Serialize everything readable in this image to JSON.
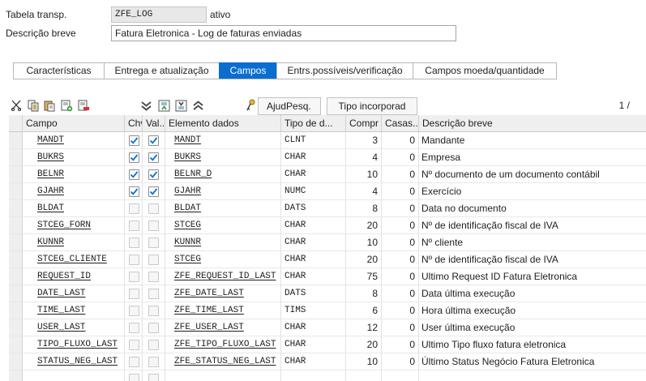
{
  "header": {
    "table_label": "Tabela transp.",
    "table_value": "ZFE_LOG",
    "status": "ativo",
    "desc_label": "Descrição breve",
    "desc_value": "Fatura Eletronica - Log de faturas enviadas"
  },
  "tabs": [
    {
      "label": "Características",
      "active": false
    },
    {
      "label": "Entrega e atualização",
      "active": false
    },
    {
      "label": "Campos",
      "active": true
    },
    {
      "label": "Entrs.possíveis/verificação",
      "active": false
    },
    {
      "label": "Campos moeda/quantidade",
      "active": false
    }
  ],
  "toolbar": {
    "icons": [
      "cut-icon",
      "copy-icon",
      "paste-icon",
      "insert-row-icon",
      "delete-row-icon"
    ],
    "nav_icons": [
      "scroll-down-icon",
      "first-page-icon",
      "last-page-icon",
      "scroll-up-icon"
    ],
    "search_help_label": "AjudPesq.",
    "builtin_type_label": "Tipo incorporad",
    "pager": "1 /"
  },
  "colors": {
    "accent": "#0a6ed1",
    "check": "#0a6ed1",
    "header_bg": "#efefef"
  },
  "table": {
    "columns": [
      "Campo",
      "Chv",
      "Val...",
      "Elemento dados",
      "Tipo de d...",
      "Compr",
      "Casas...",
      "Descrição breve"
    ],
    "rows": [
      {
        "field": "MANDT",
        "key": true,
        "init": true,
        "element": "MANDT",
        "type": "CLNT",
        "length": "3",
        "decimals": "0",
        "desc": "Mandante"
      },
      {
        "field": "BUKRS",
        "key": true,
        "init": true,
        "element": "BUKRS",
        "type": "CHAR",
        "length": "4",
        "decimals": "0",
        "desc": "Empresa"
      },
      {
        "field": "BELNR",
        "key": true,
        "init": true,
        "element": "BELNR_D",
        "type": "CHAR",
        "length": "10",
        "decimals": "0",
        "desc": "Nº documento de um documento contábil"
      },
      {
        "field": "GJAHR",
        "key": true,
        "init": true,
        "element": "GJAHR",
        "type": "NUMC",
        "length": "4",
        "decimals": "0",
        "desc": "Exercício"
      },
      {
        "field": "BLDAT",
        "key": false,
        "init": false,
        "element": "BLDAT",
        "type": "DATS",
        "length": "8",
        "decimals": "0",
        "desc": "Data no documento"
      },
      {
        "field": "STCEG_FORN",
        "key": false,
        "init": false,
        "element": "STCEG",
        "type": "CHAR",
        "length": "20",
        "decimals": "0",
        "desc": "Nº de identificação fiscal de IVA"
      },
      {
        "field": "KUNNR",
        "key": false,
        "init": false,
        "element": "KUNNR",
        "type": "CHAR",
        "length": "10",
        "decimals": "0",
        "desc": "Nº cliente"
      },
      {
        "field": "STCEG_CLIENTE",
        "key": false,
        "init": false,
        "element": "STCEG",
        "type": "CHAR",
        "length": "20",
        "decimals": "0",
        "desc": "Nº de identificação fiscal de IVA"
      },
      {
        "field": "REQUEST_ID",
        "key": false,
        "init": false,
        "element": "ZFE_REQUEST_ID_LAST",
        "type": "CHAR",
        "length": "75",
        "decimals": "0",
        "desc": "Ultimo Request ID Fatura Eletronica"
      },
      {
        "field": "DATE_LAST",
        "key": false,
        "init": false,
        "element": "ZFE_DATE_LAST",
        "type": "DATS",
        "length": "8",
        "decimals": "0",
        "desc": "Data última execução"
      },
      {
        "field": "TIME_LAST",
        "key": false,
        "init": false,
        "element": "ZFE_TIME_LAST",
        "type": "TIMS",
        "length": "6",
        "decimals": "0",
        "desc": "Hora última execução"
      },
      {
        "field": "USER_LAST",
        "key": false,
        "init": false,
        "element": "ZFE_USER_LAST",
        "type": "CHAR",
        "length": "12",
        "decimals": "0",
        "desc": "User última execução"
      },
      {
        "field": "TIPO_FLUXO_LAST",
        "key": false,
        "init": false,
        "element": "ZFE_TIPO_FLUXO_LAST",
        "type": "CHAR",
        "length": "20",
        "decimals": "0",
        "desc": "Ultimo Tipo fluxo fatura eletronica"
      },
      {
        "field": "STATUS_NEG_LAST",
        "key": false,
        "init": false,
        "element": "ZFE_STATUS_NEG_LAST",
        "type": "CHAR",
        "length": "10",
        "decimals": "0",
        "desc": "Último Status Negócio Fatura Eletronica"
      },
      {
        "field": "",
        "key": false,
        "init": false,
        "element": "",
        "type": "",
        "length": "",
        "decimals": "",
        "desc": ""
      }
    ]
  }
}
